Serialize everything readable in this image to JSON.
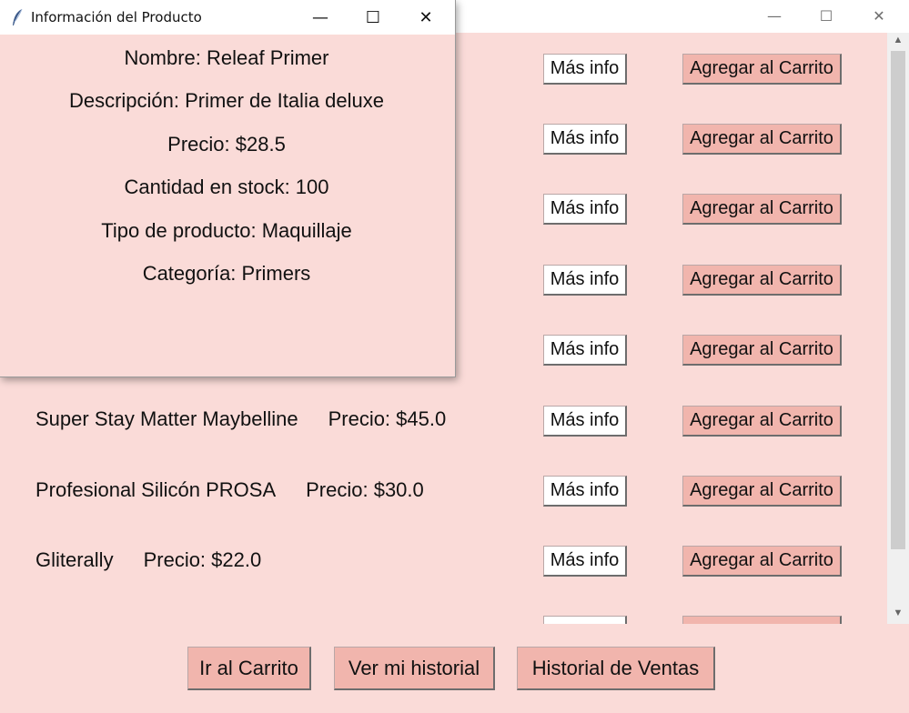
{
  "main_window": {
    "controls": {
      "minimize": "—",
      "maximize": "☐",
      "close": "✕"
    },
    "rows": [
      {
        "name": "",
        "price": "",
        "info_label": "Más info",
        "cart_label": "Agregar al Carrito"
      },
      {
        "name": "",
        "price": "",
        "info_label": "Más info",
        "cart_label": "Agregar al Carrito"
      },
      {
        "name": "",
        "price": "",
        "info_label": "Más info",
        "cart_label": "Agregar al Carrito"
      },
      {
        "name": "",
        "price": "",
        "info_label": "Más info",
        "cart_label": "Agregar al Carrito"
      },
      {
        "name": "",
        "price": "",
        "info_label": "Más info",
        "cart_label": "Agregar al Carrito"
      },
      {
        "name": "Super Stay Matter Maybelline",
        "price": "Precio: $45.0",
        "info_label": "Más info",
        "cart_label": "Agregar al Carrito"
      },
      {
        "name": "Profesional Silicón PROSA",
        "price": "Precio: $30.0",
        "info_label": "Más info",
        "cart_label": "Agregar al Carrito"
      },
      {
        "name": "Gliterally",
        "price": "Precio: $22.0",
        "info_label": "Más info",
        "cart_label": "Agregar al Carrito"
      }
    ],
    "bottom_buttons": {
      "cart": "Ir al Carrito",
      "history": "Ver mi historial",
      "sales": "Historial de Ventas"
    }
  },
  "popup": {
    "title": "Información del Producto",
    "controls": {
      "minimize": "—",
      "maximize": "☐",
      "close": "✕"
    },
    "lines": [
      "Nombre: Releaf Primer",
      "Descripción: Primer de Italia deluxe",
      "Precio: $28.5",
      "Cantidad en stock: 100",
      "Tipo de producto: Maquillaje",
      "Categoría: Primers"
    ]
  },
  "colors": {
    "background": "#fadbd8",
    "cart_button": "#f1b5ad",
    "info_button": "#ffffff"
  }
}
